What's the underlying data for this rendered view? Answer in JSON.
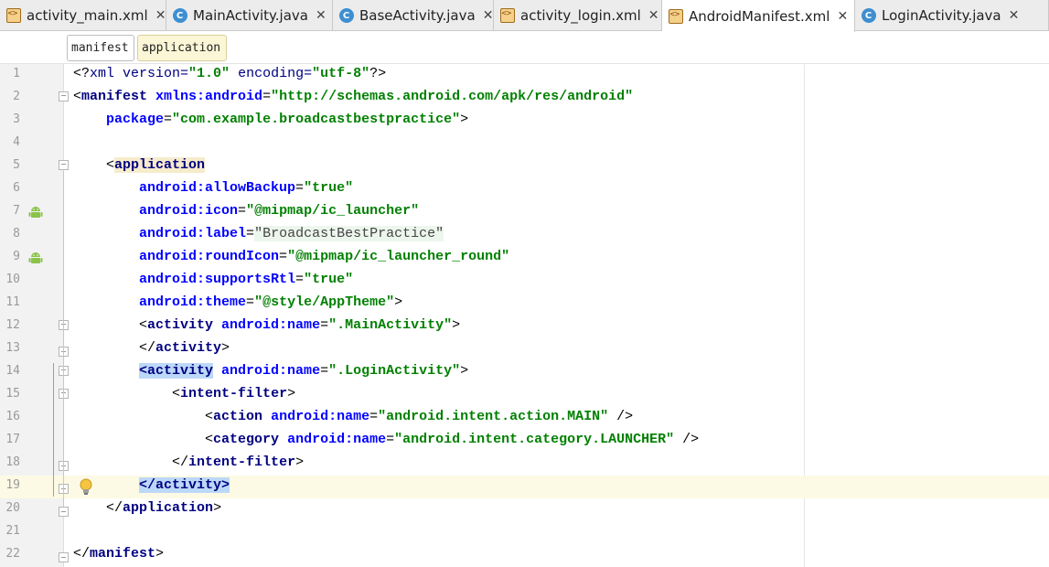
{
  "tabs": [
    {
      "label": "activity_main.xml",
      "icon": "xml-file-icon",
      "active": false
    },
    {
      "label": "MainActivity.java",
      "icon": "java-class-icon",
      "active": false
    },
    {
      "label": "BaseActivity.java",
      "icon": "java-class-icon",
      "active": false
    },
    {
      "label": "activity_login.xml",
      "icon": "xml-file-icon",
      "active": false
    },
    {
      "label": "AndroidManifest.xml",
      "icon": "manifest-file-icon",
      "active": true
    },
    {
      "label": "LoginActivity.java",
      "icon": "java-class-icon",
      "active": false
    }
  ],
  "close_glyph": "✕",
  "breadcrumb": [
    "manifest",
    "application"
  ],
  "editor": {
    "current_line": 19,
    "lines": [
      {
        "n": "1",
        "parts": [
          [
            "punc",
            "<?"
          ],
          [
            "proc",
            "xml version="
          ],
          [
            "val",
            "\"1.0\""
          ],
          [
            "proc",
            " encoding="
          ],
          [
            "val",
            "\"utf-8\""
          ],
          [
            "punc",
            "?>"
          ]
        ]
      },
      {
        "n": "2",
        "parts": [
          [
            "punc",
            "<"
          ],
          [
            "tag",
            "manifest "
          ],
          [
            "attr",
            "xmlns:android"
          ],
          [
            "punc",
            "="
          ],
          [
            "val",
            "\"http://schemas.android.com/apk/res/android\""
          ]
        ]
      },
      {
        "n": "3",
        "parts": [
          [
            "lit",
            "    "
          ],
          [
            "attr",
            "package"
          ],
          [
            "punc",
            "="
          ],
          [
            "val",
            "\"com.example.broadcastbestpractice\""
          ],
          [
            "punc",
            ">"
          ]
        ]
      },
      {
        "n": "4",
        "parts": []
      },
      {
        "n": "5",
        "parts": [
          [
            "lit",
            "    "
          ],
          [
            "punc",
            "<"
          ],
          [
            "tag-hly",
            "application"
          ]
        ]
      },
      {
        "n": "6",
        "parts": [
          [
            "lit",
            "        "
          ],
          [
            "attr",
            "android:allowBackup"
          ],
          [
            "punc",
            "="
          ],
          [
            "val",
            "\"true\""
          ]
        ]
      },
      {
        "n": "7",
        "parts": [
          [
            "lit",
            "        "
          ],
          [
            "attr",
            "android:icon"
          ],
          [
            "punc",
            "="
          ],
          [
            "val",
            "\"@mipmap/ic_launcher\""
          ]
        ]
      },
      {
        "n": "8",
        "parts": [
          [
            "lit",
            "        "
          ],
          [
            "attr",
            "android:label"
          ],
          [
            "punc",
            "="
          ],
          [
            "val-hlg",
            "\"BroadcastBestPractice\""
          ]
        ]
      },
      {
        "n": "9",
        "parts": [
          [
            "lit",
            "        "
          ],
          [
            "attr",
            "android:roundIcon"
          ],
          [
            "punc",
            "="
          ],
          [
            "val",
            "\"@mipmap/ic_launcher_round\""
          ]
        ]
      },
      {
        "n": "10",
        "parts": [
          [
            "lit",
            "        "
          ],
          [
            "attr",
            "android:supportsRtl"
          ],
          [
            "punc",
            "="
          ],
          [
            "val",
            "\"true\""
          ]
        ]
      },
      {
        "n": "11",
        "parts": [
          [
            "lit",
            "        "
          ],
          [
            "attr",
            "android:theme"
          ],
          [
            "punc",
            "="
          ],
          [
            "val",
            "\"@style/AppTheme\""
          ],
          [
            "punc",
            ">"
          ]
        ]
      },
      {
        "n": "12",
        "parts": [
          [
            "lit",
            "        "
          ],
          [
            "punc",
            "<"
          ],
          [
            "tag",
            "activity "
          ],
          [
            "attr",
            "android:name"
          ],
          [
            "punc",
            "="
          ],
          [
            "val",
            "\".MainActivity\""
          ],
          [
            "punc",
            ">"
          ]
        ]
      },
      {
        "n": "13",
        "parts": [
          [
            "lit",
            "        "
          ],
          [
            "punc",
            "</"
          ],
          [
            "tag",
            "activity"
          ],
          [
            "punc",
            ">"
          ]
        ]
      },
      {
        "n": "14",
        "parts": [
          [
            "lit",
            "        "
          ],
          [
            "tag-hlb",
            "<activity"
          ],
          [
            "lit",
            " "
          ],
          [
            "attr",
            "android:name"
          ],
          [
            "punc",
            "="
          ],
          [
            "val",
            "\".LoginActivity\""
          ],
          [
            "punc",
            ">"
          ]
        ]
      },
      {
        "n": "15",
        "parts": [
          [
            "lit",
            "            "
          ],
          [
            "punc",
            "<"
          ],
          [
            "tag",
            "intent-filter"
          ],
          [
            "punc",
            ">"
          ]
        ]
      },
      {
        "n": "16",
        "parts": [
          [
            "lit",
            "                "
          ],
          [
            "punc",
            "<"
          ],
          [
            "tag",
            "action "
          ],
          [
            "attr",
            "android:name"
          ],
          [
            "punc",
            "="
          ],
          [
            "val",
            "\"android.intent.action.MAIN\""
          ],
          [
            "punc",
            " />"
          ]
        ]
      },
      {
        "n": "17",
        "parts": [
          [
            "lit",
            "                "
          ],
          [
            "punc",
            "<"
          ],
          [
            "tag",
            "category "
          ],
          [
            "attr",
            "android:name"
          ],
          [
            "punc",
            "="
          ],
          [
            "val",
            "\"android.intent.category.LAUNCHER\""
          ],
          [
            "punc",
            " />"
          ]
        ]
      },
      {
        "n": "18",
        "parts": [
          [
            "lit",
            "            "
          ],
          [
            "punc",
            "</"
          ],
          [
            "tag",
            "intent-filter"
          ],
          [
            "punc",
            ">"
          ]
        ]
      },
      {
        "n": "19",
        "parts": [
          [
            "lit",
            "        "
          ],
          [
            "tag-hlb",
            "</activity>"
          ]
        ]
      },
      {
        "n": "20",
        "parts": [
          [
            "lit",
            "    "
          ],
          [
            "punc",
            "</"
          ],
          [
            "tag",
            "application"
          ],
          [
            "punc",
            ">"
          ]
        ]
      },
      {
        "n": "21",
        "parts": []
      },
      {
        "n": "22",
        "parts": [
          [
            "punc",
            "</"
          ],
          [
            "tag",
            "manifest"
          ],
          [
            "punc",
            ">"
          ]
        ]
      }
    ],
    "gutter_icons": {
      "7": "android-icon",
      "9": "android-icon",
      "19": "lightbulb-icon"
    }
  },
  "colors": {
    "tag": "#000080",
    "attribute": "#0000ff",
    "value": "#008000",
    "current_line": "#fcfae4",
    "tag_match": "#bcd8f8"
  }
}
